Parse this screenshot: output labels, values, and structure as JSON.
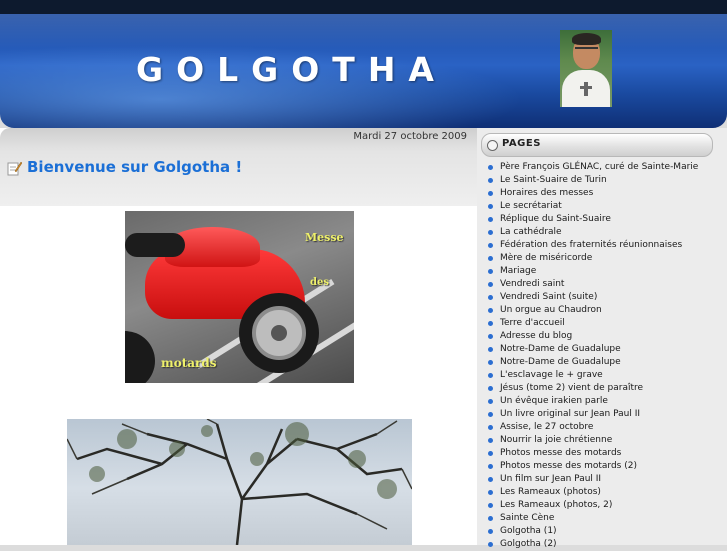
{
  "header": {
    "site_title": "GOLGOTHA"
  },
  "post": {
    "date": "Mardi 27 octobre 2009",
    "title": "Bienvenue sur Golgotha !",
    "photo_captions": [
      "Messe",
      "des",
      "motards"
    ]
  },
  "sidebar": {
    "title": "PAGES",
    "items": [
      "Père François GLÉNAC, curé de Sainte-Marie",
      "Le Saint-Suaire de Turin",
      "Horaires des messes",
      "Le secrétariat",
      "Réplique du Saint-Suaire",
      "La cathédrale",
      "Fédération des fraternités réunionnaises",
      "Mère de miséricorde",
      "Mariage",
      "Vendredi saint",
      "Vendredi Saint (suite)",
      "Un orgue au Chaudron",
      "Terre d'accueil",
      "Adresse du blog",
      "Notre-Dame de Guadalupe",
      "Notre-Dame de Guadalupe",
      "L'esclavage le + grave",
      "Jésus (tome 2) vient de paraître",
      "Un évêque irakien parle",
      "Un livre original sur Jean Paul II",
      "Assise, le 27 octobre",
      "Nourrir la joie chrétienne",
      "Photos messe des motards",
      "Photos messe des motards (2)",
      "Un film sur Jean Paul II",
      "Les Rameaux (photos)",
      "Les Rameaux (photos, 2)",
      "Sainte Cène",
      "Golgotha (1)",
      "Golgotha (2)"
    ]
  }
}
